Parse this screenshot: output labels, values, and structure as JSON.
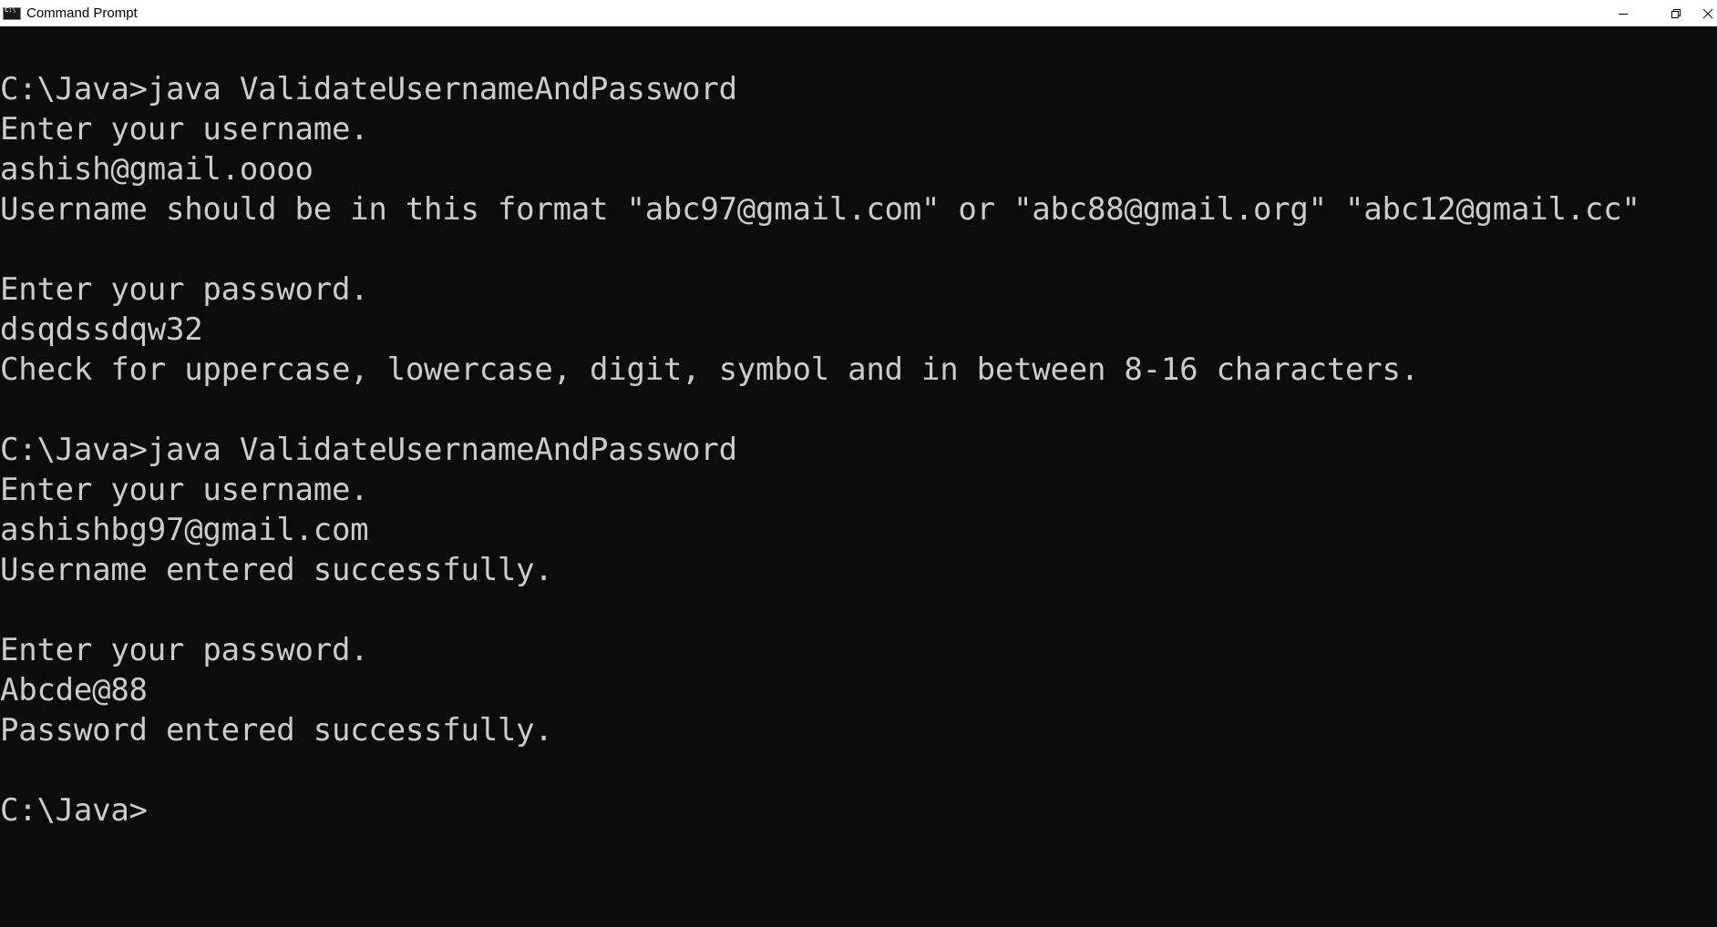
{
  "window": {
    "title": "Command Prompt",
    "icon": "cmd-icon",
    "controls": [
      "minimize-icon",
      "restore-icon",
      "close-icon"
    ]
  },
  "colors": {
    "console_bg": "#0c0c0c",
    "console_text": "#cccccc",
    "titlebar_bg": "#ffffff"
  },
  "console": {
    "lines": [
      "C:\\Java>java ValidateUsernameAndPassword",
      "Enter your username.",
      "ashish@gmail.oooo",
      "Username should be in this format \"abc97@gmail.com\" or \"abc88@gmail.org\" \"abc12@gmail.cc\"",
      "",
      "Enter your password.",
      "dsqdssdqw32",
      "Check for uppercase, lowercase, digit, symbol and in between 8-16 characters.",
      "",
      "C:\\Java>java ValidateUsernameAndPassword",
      "Enter your username.",
      "ashishbg97@gmail.com",
      "Username entered successfully.",
      "",
      "Enter your password.",
      "Abcde@88",
      "Password entered successfully.",
      "",
      "C:\\Java>"
    ]
  }
}
